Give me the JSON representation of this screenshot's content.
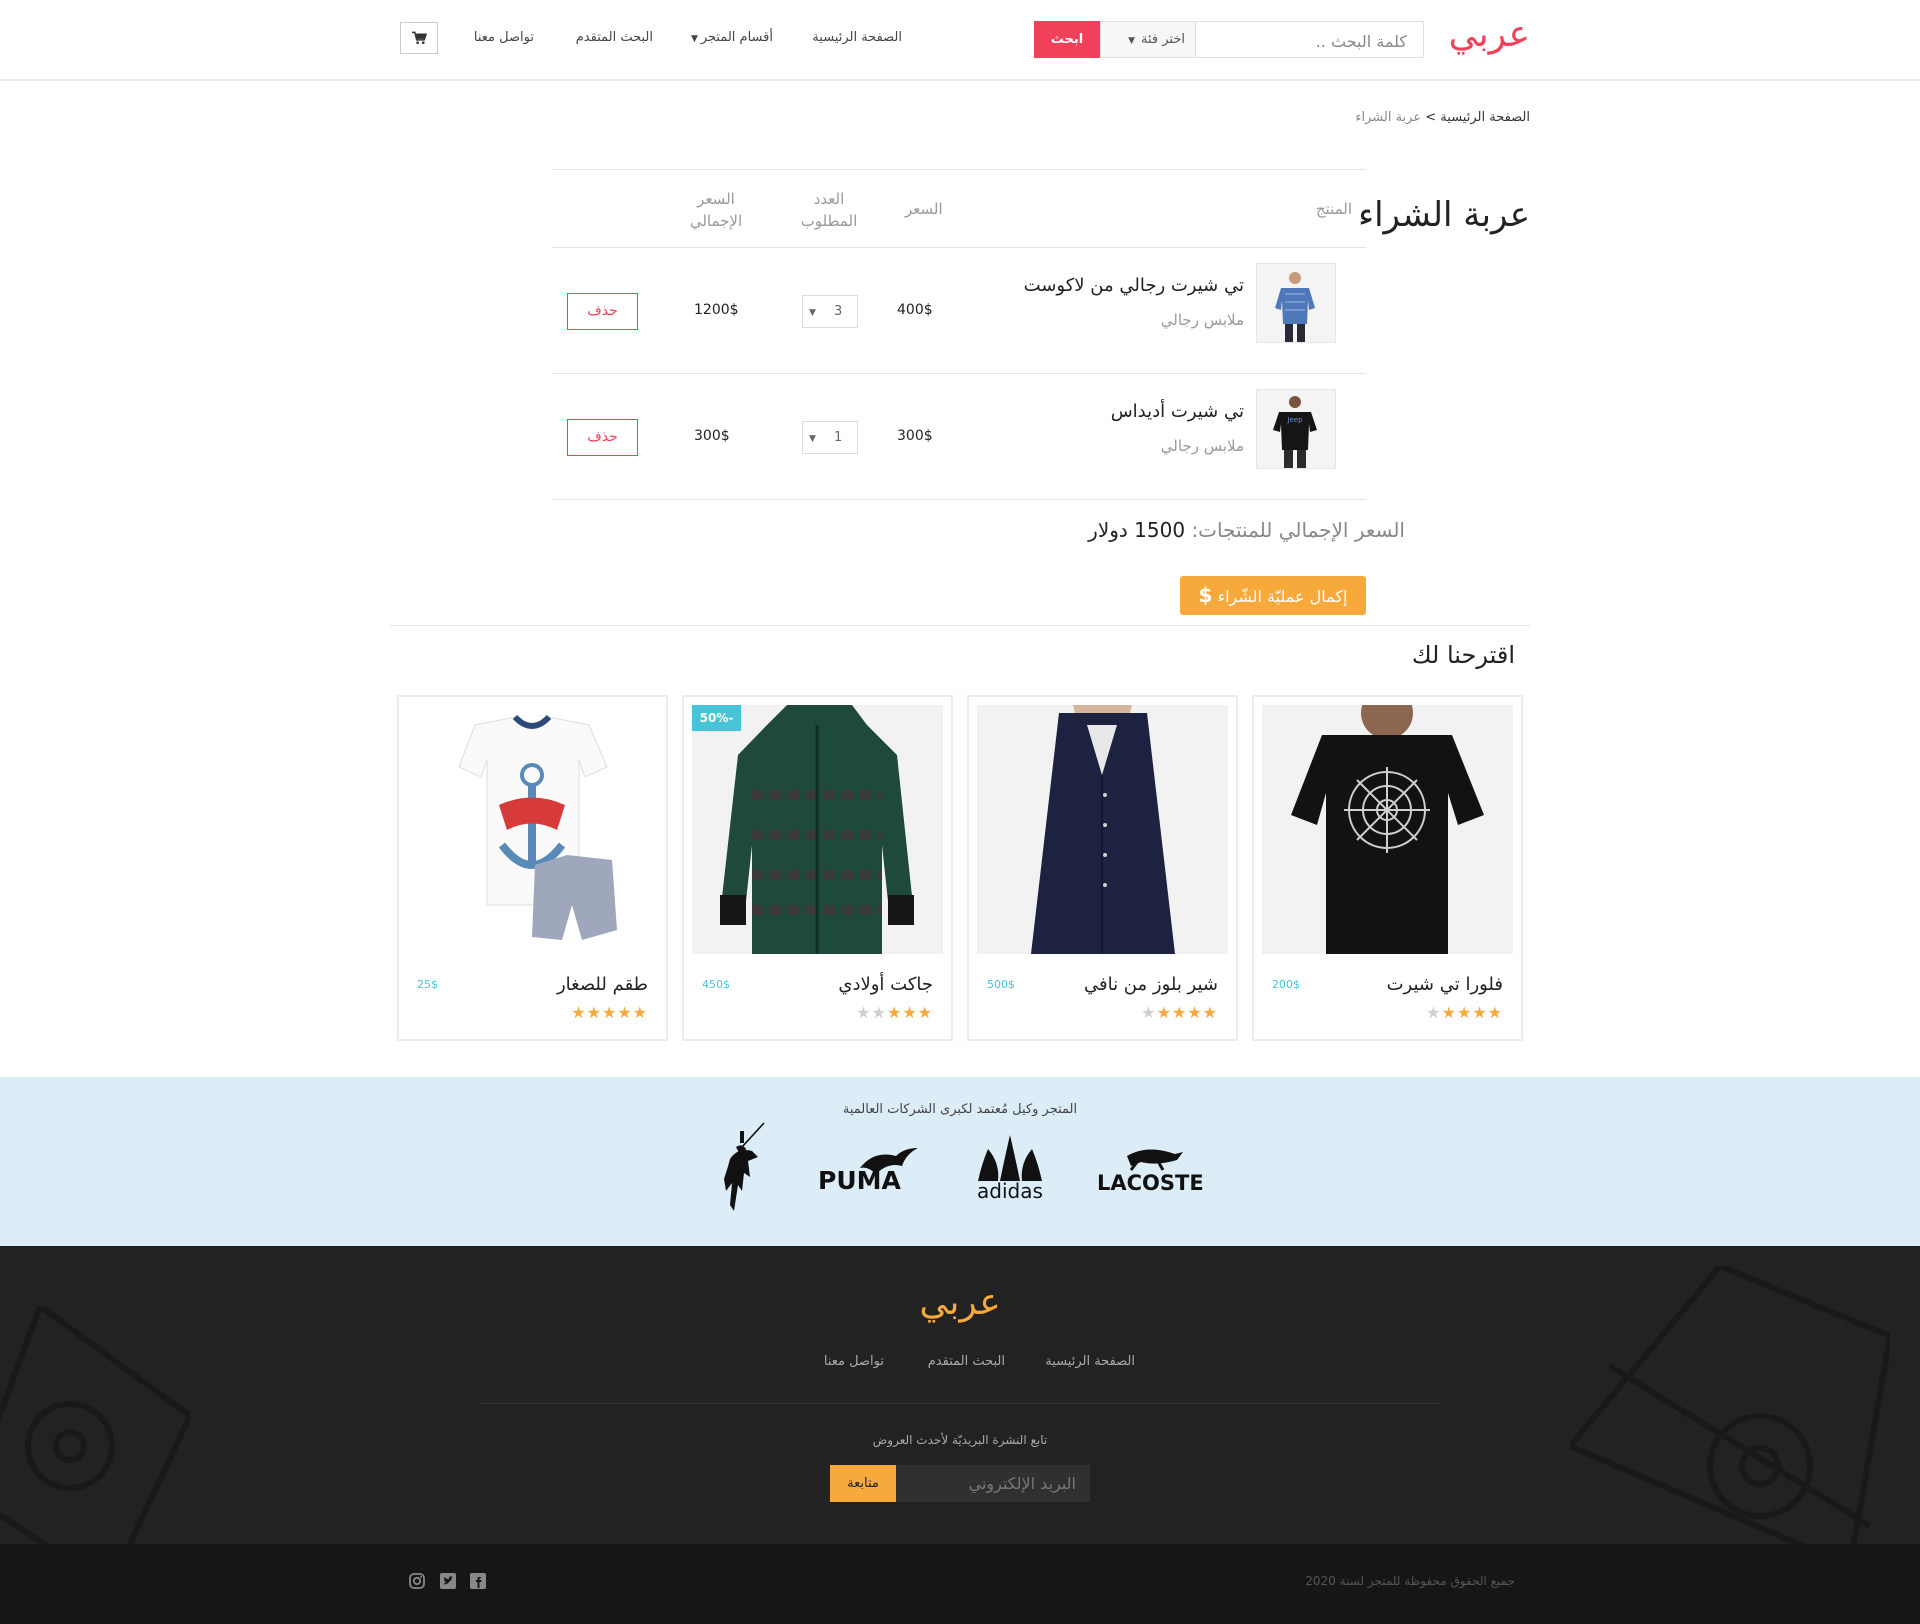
{
  "header": {
    "logo": "عربي",
    "search_placeholder": "كلمة البحث ..",
    "category_select": "اختر فئة",
    "search_button": "ابحث",
    "nav": {
      "home": "الصفحة الرئيسية",
      "sections": "أقسام المتجر",
      "advanced": "البحث المتقدم",
      "contact": "تواصل معنا"
    }
  },
  "breadcrumb": {
    "home": "الصفحة الرئيسية",
    "separator": ">",
    "current": "عربة الشراء"
  },
  "cart": {
    "title": "عربة الشراء",
    "columns": {
      "product": "المنتج",
      "price": "السعر",
      "qty": "العدد المطلوب",
      "total": "السعر الإجمالي"
    },
    "items": [
      {
        "name": "تي شيرت رجالي من لاكوست",
        "category": "ملابس رجالي",
        "price": "400$",
        "qty": "3",
        "total": "1200$",
        "delete": "حذف"
      },
      {
        "name": "تي شيرت أديداس",
        "category": "ملابس رجالي",
        "price": "300$",
        "qty": "1",
        "total": "300$",
        "delete": "حذف"
      }
    ],
    "grand_label": "السعر الإجمالي للمنتجات:",
    "grand_value": "1500 دولار",
    "checkout": "إكمال عمليّة الشّراء"
  },
  "suggestions": {
    "title": "اقترحنا لك",
    "items": [
      {
        "name": "فلورا تي شيرت",
        "price": "200$",
        "rating": 4
      },
      {
        "name": "شير بلوز من نافي",
        "price": "500$",
        "rating": 4
      },
      {
        "name": "جاكت أولادي",
        "price": "450$",
        "rating": 3,
        "badge": "-50%"
      },
      {
        "name": "طقم للصغار",
        "price": "25$",
        "rating": 5
      }
    ]
  },
  "brands": {
    "caption": "المتجر وكيل مُعتمد لكبرى الشركات العالمية",
    "names": [
      "LACOSTE",
      "adidas",
      "PUMA"
    ]
  },
  "footer": {
    "logo": "عربي",
    "nav": {
      "home": "الصفحة الرئيسية",
      "advanced": "البحث المتقدم",
      "contact": "تواصل معنا"
    },
    "newsletter": "تابع النشرة البريديّة لأحدث العروض",
    "email_placeholder": "البريد الإلكتروني",
    "subscribe": "متابعة",
    "copyright": "جميع الحقوق محفوظة للمتجر لسنة 2020"
  },
  "colors": {
    "accent": "#f0405a",
    "orange": "#f7a93c",
    "teal": "#47c4d6"
  }
}
